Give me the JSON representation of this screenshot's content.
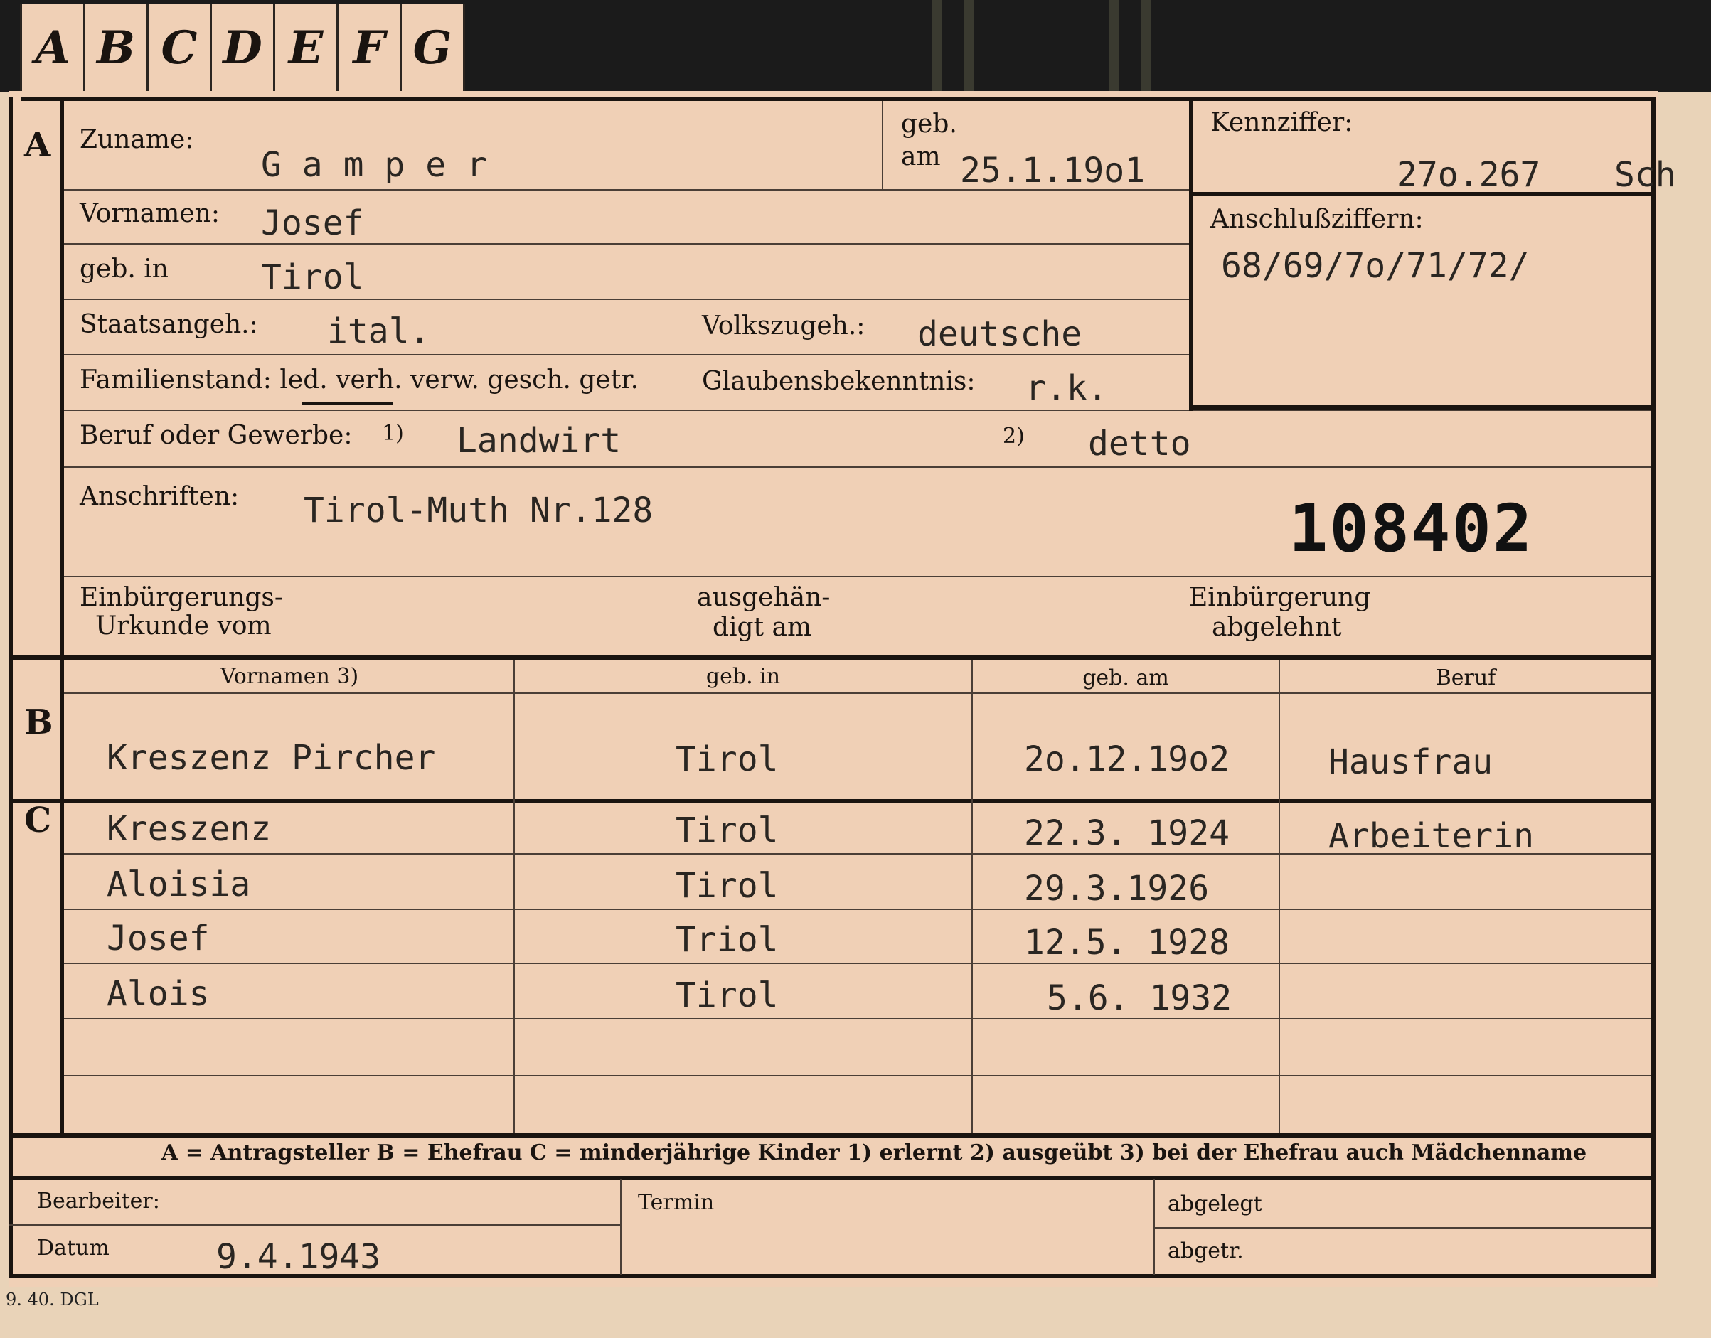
{
  "tabs": [
    "A",
    "B",
    "C",
    "D",
    "E",
    "F",
    "G"
  ],
  "sections": {
    "a": "A",
    "b": "B",
    "c": "C"
  },
  "applicant": {
    "surname_label": "Zuname:",
    "surname": "G a m p e r",
    "born_label_top": "geb.",
    "born_label_bottom": "am",
    "born_date": "25.1.19o1",
    "given_names_label": "Vornamen:",
    "given_names": "Josef",
    "birthplace_label": "geb. in",
    "birthplace": "Tirol",
    "citizenship_label": "Staatsangeh.:",
    "citizenship": "ital.",
    "ethnicity_label": "Volkszugeh.:",
    "ethnicity": "deutsche",
    "marital_label": "Familienstand: led. verh. verw. gesch. getr.",
    "religion_label": "Glaubensbekenntnis:",
    "religion": "r.k.",
    "occupation_label": "Beruf oder Gewerbe:",
    "occupation_note_1": "1)",
    "occupation_1": "Landwirt",
    "occupation_note_2": "2)",
    "occupation_2": "detto",
    "address_label": "Anschriften:",
    "address": "Tirol-Muth Nr.128",
    "stamp_number": "108402",
    "naturalization_cert_label_1": "Einbürgerungs-",
    "naturalization_cert_label_2": "Urkunde vom",
    "handed_label_1": "ausgehän-",
    "handed_label_2": "digt am",
    "naturalization_denied_label_1": "Einbürgerung",
    "naturalization_denied_label_2": "abgelehnt"
  },
  "reference": {
    "id_label": "Kennziffer:",
    "id_value": "27o.267",
    "id_suffix": "Sch",
    "linked_label": "Anschlußziffern:",
    "linked_value": "68/69/7o/71/72/"
  },
  "family_table": {
    "headers": [
      "Vornamen 3)",
      "geb. in",
      "geb. am",
      "Beruf"
    ],
    "spouse": {
      "name": "Kreszenz Pircher",
      "place": "Tirol",
      "date": "2o.12.19o2",
      "job": "Hausfrau"
    },
    "children": [
      {
        "name": "Kreszenz",
        "place": "Tirol",
        "date": "22.3. 1924",
        "job": "Arbeiterin"
      },
      {
        "name": "Aloisia",
        "place": "Tirol",
        "date": "29.3.1926",
        "job": ""
      },
      {
        "name": "Josef",
        "place": "Triol",
        "date": "12.5. 1928",
        "job": ""
      },
      {
        "name": "Alois",
        "place": "Tirol",
        "date": "5.6. 1932",
        "job": ""
      }
    ]
  },
  "legend": "A = Antragsteller   B = Ehefrau   C = minderjährige Kinder   1) erlernt   2) ausgeübt   3) bei der Ehefrau auch Mädchenname",
  "footer": {
    "clerk_label": "Bearbeiter:",
    "date_label": "Datum",
    "date_value": "9.4.1943",
    "deadline_label": "Termin",
    "filed_label": "abgelegt",
    "removed_label": "abgetr."
  },
  "print_mark": "9. 40. DGL"
}
